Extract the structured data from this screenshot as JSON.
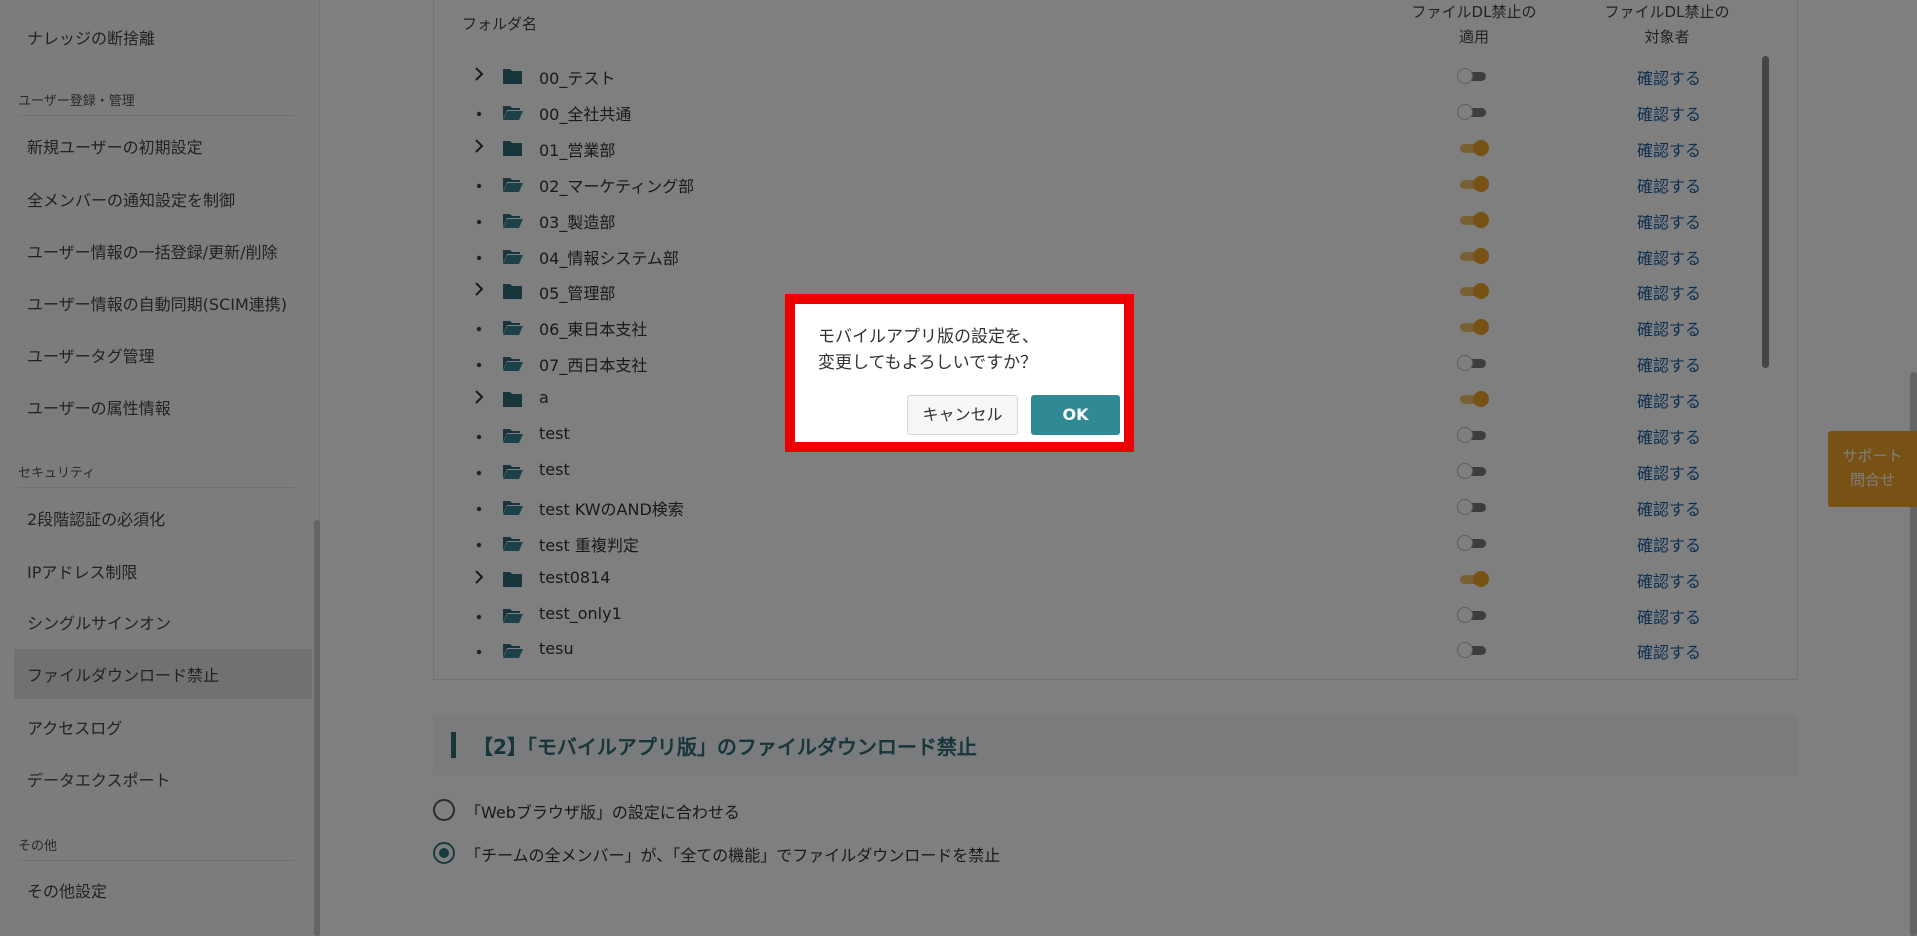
{
  "sidebar": {
    "items_top": [
      "ナレッジの断捨離"
    ],
    "section_user": "ユーザー登録・管理",
    "user_items": [
      "新規ユーザーの初期設定",
      "全メンバーの通知設定を制御",
      "ユーザー情報の一括登録/更新/削除",
      "ユーザー情報の自動同期(SCIM連携)",
      "ユーザータグ管理",
      "ユーザーの属性情報"
    ],
    "section_security": "セキュリティ",
    "security_items": [
      "2段階認証の必須化",
      "IPアドレス制限",
      "シングルサインオン",
      "ファイルダウンロード禁止",
      "アクセスログ",
      "データエクスポート"
    ],
    "section_other": "その他",
    "other_items": [
      "その他設定"
    ]
  },
  "table": {
    "col_folder": "フォルダ名",
    "col_apply": "ファイルDL禁止の\n適用",
    "col_target": "ファイルDL禁止の\n対象者",
    "confirm_label": "確認する",
    "rows": [
      {
        "name": "00_テスト",
        "expandable": true,
        "open": false,
        "on": false
      },
      {
        "name": "00_全社共通",
        "expandable": false,
        "open": true,
        "on": false
      },
      {
        "name": "01_営業部",
        "expandable": true,
        "open": false,
        "on": true
      },
      {
        "name": "02_マーケティング部",
        "expandable": false,
        "open": true,
        "on": true
      },
      {
        "name": "03_製造部",
        "expandable": false,
        "open": true,
        "on": true
      },
      {
        "name": "04_情報システム部",
        "expandable": false,
        "open": true,
        "on": true
      },
      {
        "name": "05_管理部",
        "expandable": true,
        "open": false,
        "on": true
      },
      {
        "name": "06_東日本支社",
        "expandable": false,
        "open": true,
        "on": true
      },
      {
        "name": "07_西日本支社",
        "expandable": false,
        "open": true,
        "on": false
      },
      {
        "name": "a",
        "expandable": true,
        "open": false,
        "on": true
      },
      {
        "name": "test",
        "expandable": false,
        "open": true,
        "on": false
      },
      {
        "name": "test",
        "expandable": false,
        "open": true,
        "on": false
      },
      {
        "name": "test KWのAND検索",
        "expandable": false,
        "open": true,
        "on": false
      },
      {
        "name": "test 重複判定",
        "expandable": false,
        "open": true,
        "on": false
      },
      {
        "name": "test0814",
        "expandable": true,
        "open": false,
        "on": true
      },
      {
        "name": "test_only1",
        "expandable": false,
        "open": true,
        "on": false
      },
      {
        "name": "tesu",
        "expandable": false,
        "open": true,
        "on": false
      }
    ]
  },
  "section2": {
    "title": "【2】「モバイルアプリ版」のファイルダウンロード禁止",
    "options": [
      {
        "label": "「Webブラウザ版」の設定に合わせる",
        "checked": false
      },
      {
        "label": "「チームの全メンバー」が、「全ての機能」でファイルダウンロードを禁止",
        "checked": true
      }
    ]
  },
  "support": {
    "line1": "サポート",
    "line2": "問合せ"
  },
  "dialog": {
    "line1": "モバイルアプリ版の設定を、",
    "line2": "変更してもよろしいですか？",
    "cancel": "キャンセル",
    "ok": "OK"
  },
  "colors": {
    "accent": "#2f8a96",
    "toggle_on": "#f0a22a",
    "link": "#1a5f9e",
    "highlight": "#ee0000"
  }
}
